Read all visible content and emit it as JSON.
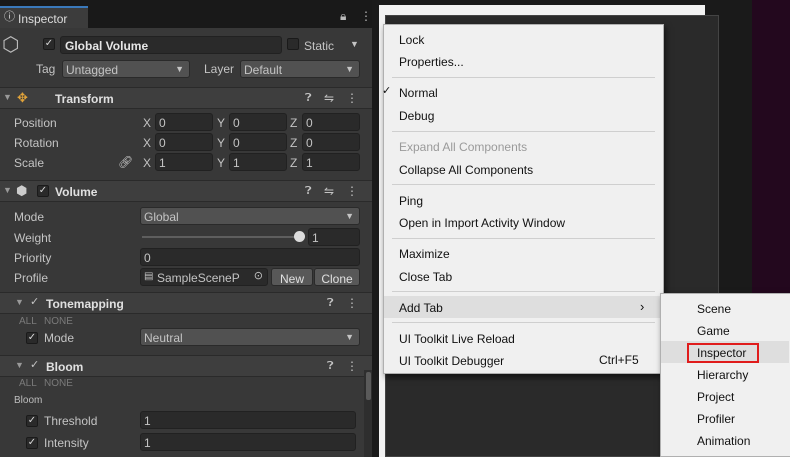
{
  "inspector": {
    "tab_title": "Inspector",
    "object_name": "Global Volume",
    "static_label": "Static",
    "tag_label": "Tag",
    "tag_value": "Untagged",
    "layer_label": "Layer",
    "layer_value": "Default",
    "transform": {
      "title": "Transform",
      "position_label": "Position",
      "rotation_label": "Rotation",
      "scale_label": "Scale",
      "axis_x": "X",
      "axis_y": "Y",
      "axis_z": "Z",
      "position": [
        "0",
        "0",
        "0"
      ],
      "rotation": [
        "0",
        "0",
        "0"
      ],
      "scale": [
        "1",
        "1",
        "1"
      ]
    },
    "volume": {
      "title": "Volume",
      "mode_label": "Mode",
      "mode_value": "Global",
      "weight_label": "Weight",
      "weight_value": "1",
      "priority_label": "Priority",
      "priority_value": "0",
      "profile_label": "Profile",
      "profile_value": "SampleSceneP",
      "new_button": "New",
      "clone_button": "Clone"
    },
    "tonemapping": {
      "title": "Tonemapping",
      "all_label": "ALL",
      "none_label": "NONE",
      "mode_label": "Mode",
      "mode_value": "Neutral"
    },
    "bloom": {
      "title": "Bloom",
      "all_label": "ALL",
      "none_label": "NONE",
      "section_label": "Bloom",
      "threshold_label": "Threshold",
      "threshold_value": "1",
      "intensity_label": "Intensity",
      "intensity_value": "1"
    }
  },
  "context_menu": {
    "lock": "Lock",
    "properties": "Properties...",
    "normal": "Normal",
    "debug": "Debug",
    "expand_all": "Expand All Components",
    "collapse_all": "Collapse All Components",
    "ping": "Ping",
    "open_import": "Open in Import Activity Window",
    "maximize": "Maximize",
    "close_tab": "Close Tab",
    "add_tab": "Add Tab",
    "live_reload": "UI Toolkit Live Reload",
    "debugger": "UI Toolkit Debugger",
    "debugger_shortcut": "Ctrl+F5"
  },
  "submenu": {
    "items": [
      "Scene",
      "Game",
      "Inspector",
      "Hierarchy",
      "Project",
      "Profiler",
      "Animation"
    ]
  },
  "colors": {
    "highlight_box": "#e01c1c",
    "panel_bg": "#383838",
    "menu_bg": "#f0f0f0"
  }
}
